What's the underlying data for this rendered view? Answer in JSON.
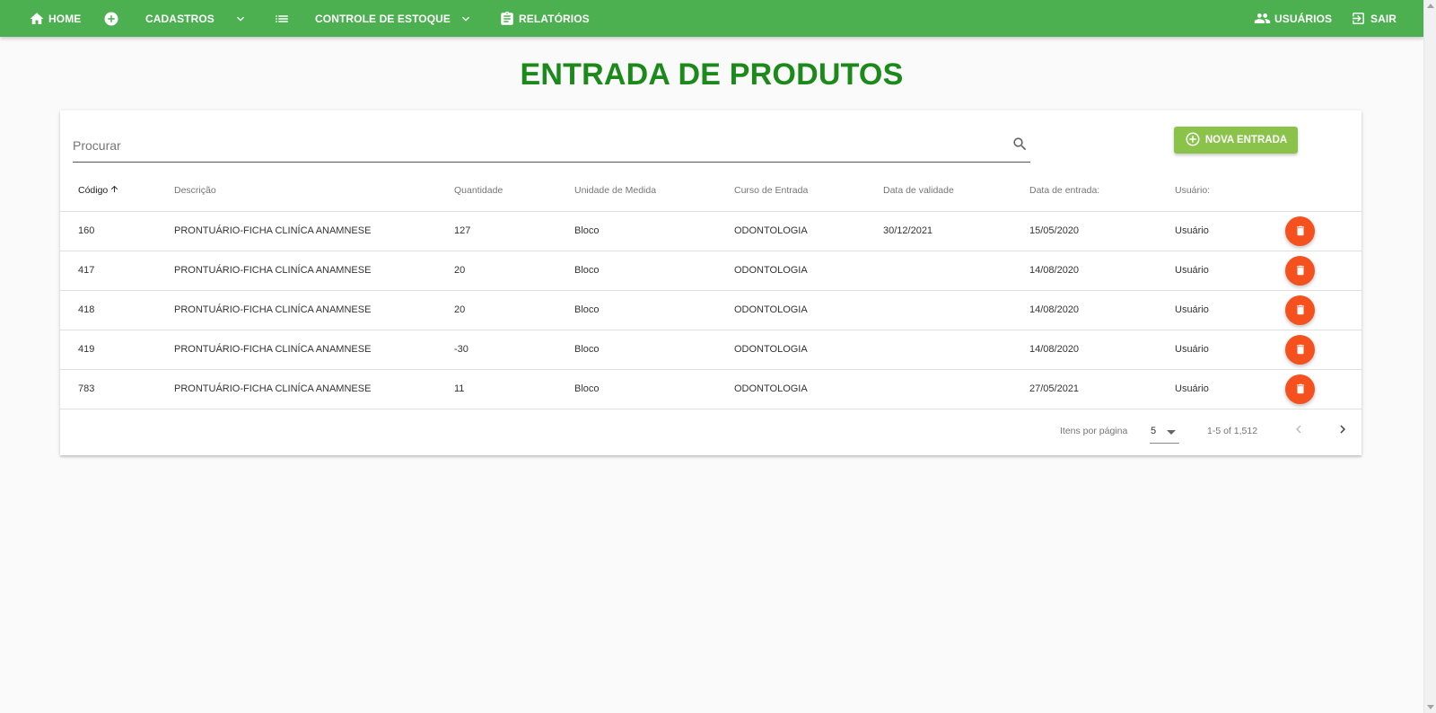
{
  "nav": {
    "home": "HOME",
    "cadastros": "CADASTROS",
    "controle_estoque": "CONTROLE DE ESTOQUE",
    "relatorios": "RELATÓRIOS",
    "usuarios": "USUÁRIOS",
    "sair": "SAIR"
  },
  "page_title": "ENTRADA DE PRODUTOS",
  "search": {
    "placeholder": "Procurar",
    "value": ""
  },
  "new_button_label": "NOVA ENTRADA",
  "table": {
    "columns": [
      "Código",
      "Descrição",
      "Quantidade",
      "Unidade de Medida",
      "Curso de Entrada",
      "Data de validade",
      "Data de entrada:",
      "Usuário:"
    ],
    "sort": {
      "column": "Código",
      "direction": "asc"
    },
    "rows": [
      [
        "160",
        "PRONTUÁRIO-FICHA CLINÍCA ANAMNESE",
        "127",
        "Bloco",
        "ODONTOLOGIA",
        "30/12/2021",
        "15/05/2020",
        "Usuário"
      ],
      [
        "417",
        "PRONTUÁRIO-FICHA CLINÍCA ANAMNESE",
        "20",
        "Bloco",
        "ODONTOLOGIA",
        "",
        "14/08/2020",
        "Usuário"
      ],
      [
        "418",
        "PRONTUÁRIO-FICHA CLINÍCA ANAMNESE",
        "20",
        "Bloco",
        "ODONTOLOGIA",
        "",
        "14/08/2020",
        "Usuário"
      ],
      [
        "419",
        "PRONTUÁRIO-FICHA CLINÍCA ANAMNESE",
        "-30",
        "Bloco",
        "ODONTOLOGIA",
        "",
        "14/08/2020",
        "Usuário"
      ],
      [
        "783",
        "PRONTUÁRIO-FICHA CLINÍCA ANAMNESE",
        "11",
        "Bloco",
        "ODONTOLOGIA",
        "",
        "27/05/2021",
        "Usuário"
      ]
    ]
  },
  "paginator": {
    "items_per_page_label": "Itens por página",
    "page_size": "5",
    "range": "1-5 of 1,512"
  },
  "colors": {
    "topbar": "#4caf50",
    "title": "#1b8a1b",
    "new_button": "#8bc34a",
    "delete_button": "#f4511e"
  },
  "icons": {
    "home": "home-icon",
    "add": "add-circle-icon",
    "list": "list-icon",
    "report": "clipboard-icon",
    "users": "people-icon",
    "logout": "exit-icon",
    "search": "search-icon",
    "delete": "trash-icon"
  }
}
